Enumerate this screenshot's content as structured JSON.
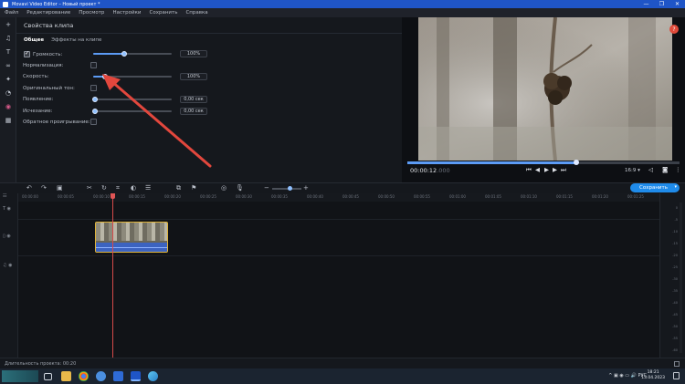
{
  "window": {
    "title": "Movavi Video Editor – Новый проект *",
    "controls": [
      "—",
      "❐",
      "✕"
    ]
  },
  "menu": [
    "Файл",
    "Редактирование",
    "Просмотр",
    "Настройки",
    "Сохранить",
    "Справка"
  ],
  "tools": [
    "plus-icon",
    "music-note-icon",
    "text-icon",
    "transition-icon",
    "magic-wand-icon",
    "sticker-icon",
    "filter-icon",
    "more-tools-icon"
  ],
  "props": {
    "heading": "Свойства клипа",
    "tabs": [
      "Общее",
      "Эффекты на клипе"
    ],
    "rows": {
      "volume": {
        "label": "Громкость:",
        "value": "100%",
        "checked": true,
        "level": 0.4
      },
      "normalize": {
        "label": "Нормализация:"
      },
      "speed": {
        "label": "Скорость:",
        "value": "100%",
        "level": 0.15
      },
      "original_pitch": {
        "label": "Оригинальный тон:"
      },
      "fade_in": {
        "label": "Появление:",
        "value": "0,00 сек"
      },
      "fade_out": {
        "label": "Исчезание:",
        "value": "0,00 сек"
      },
      "reverse": {
        "label": "Обратное проигрывание:"
      }
    }
  },
  "preview": {
    "timecode": "00:00:12",
    "timecode_frac": ".000",
    "aspect": "16:9 ▾",
    "progress": 0.62,
    "help": "?"
  },
  "timeline": {
    "save_label": "Сохранить",
    "ruler": [
      "00:00:00",
      "00:00:05",
      "00:00:10",
      "00:00:15",
      "00:00:20",
      "00:00:25",
      "00:00:30",
      "00:00:35",
      "00:00:40",
      "00:00:45",
      "00:00:50",
      "00:00:55",
      "00:01:00",
      "00:01:05",
      "00:01:10",
      "00:01:15",
      "00:01:20",
      "00:01:25"
    ],
    "vu_scale": [
      "0",
      "-5",
      "-10",
      "-15",
      "-20",
      "-25",
      "-30",
      "-35",
      "-40",
      "-45",
      "-50",
      "-55",
      "-60"
    ]
  },
  "status": {
    "duration": "Длительность проекта: 00:20"
  },
  "taskbar": {
    "tray": "^ ▣ ◉ ▭ 🔊 РУС",
    "time": "18:21",
    "date": "13.04.2023"
  },
  "colors": {
    "accent": "#1f8bea",
    "titlebar": "#1f55c7",
    "playhead": "#d64a4a",
    "clip_border": "#e0b43a",
    "arrow": "#e2473d"
  }
}
